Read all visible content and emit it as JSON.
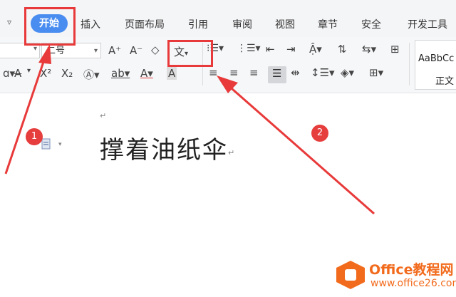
{
  "menubar": {
    "collapse_icon": "chevron-down-icon",
    "active_tab": "开始",
    "tabs": [
      "插入",
      "页面布局",
      "引用",
      "审阅",
      "视图",
      "章节",
      "安全",
      "开发工具"
    ]
  },
  "ribbon": {
    "font_size": "二号",
    "phonetic_glyph": "文",
    "style_sample": "AaBbCc",
    "style_name": "正文"
  },
  "document": {
    "heading": "撑着油纸伞",
    "paragraph_mark": "↵"
  },
  "annotations": {
    "badge_1": "1",
    "badge_2": "2",
    "highlight_color": "#e83a3a"
  },
  "watermark": {
    "title": "Office教程网",
    "url": "www.office26.com",
    "brand_color": "#f26b1d"
  }
}
